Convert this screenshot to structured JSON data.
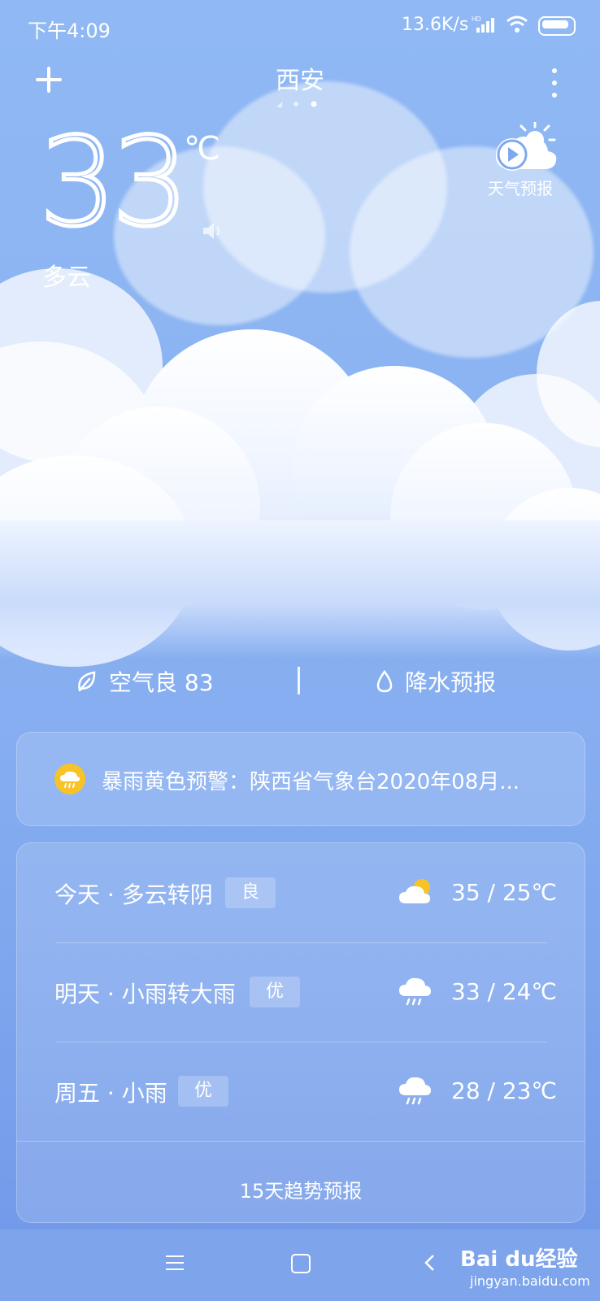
{
  "status_bar": {
    "time": "下午4:09",
    "network_speed": "13.6K/s",
    "hd_badge": "HD",
    "icons": [
      "signal-icon",
      "wifi-icon",
      "battery-icon"
    ]
  },
  "header": {
    "city": "西安",
    "page_dots": 3,
    "add_icon": "plus-icon",
    "menu_icon": "more-vert-icon"
  },
  "current": {
    "temperature": "33",
    "unit": "℃",
    "condition": "多云",
    "video_forecast_label": "天气预报"
  },
  "air_row": {
    "air_quality": "空气良 83",
    "precip": "降水预报"
  },
  "alert": {
    "text": "暴雨黄色预警：陕西省气象台2020年08月..."
  },
  "forecast": {
    "rows": [
      {
        "day": "今天 · 多云转阴",
        "aqi": "良",
        "icon": "partly-cloudy-icon",
        "range": "35 / 25℃"
      },
      {
        "day": "明天 · 小雨转大雨",
        "aqi": "优",
        "icon": "rain-cloud-icon",
        "range": "33 / 24℃"
      },
      {
        "day": "周五 · 小雨",
        "aqi": "优",
        "icon": "rain-cloud-icon",
        "range": "28 / 23℃"
      }
    ],
    "trend_label": "15天趋势预报"
  },
  "watermark": {
    "brand": "Bai du经验",
    "url": "jingyan.baidu.com"
  },
  "colors": {
    "sky_top": "#8fb8f4",
    "sky_bottom": "#6f97e8",
    "alert_icon": "#f7c326"
  }
}
